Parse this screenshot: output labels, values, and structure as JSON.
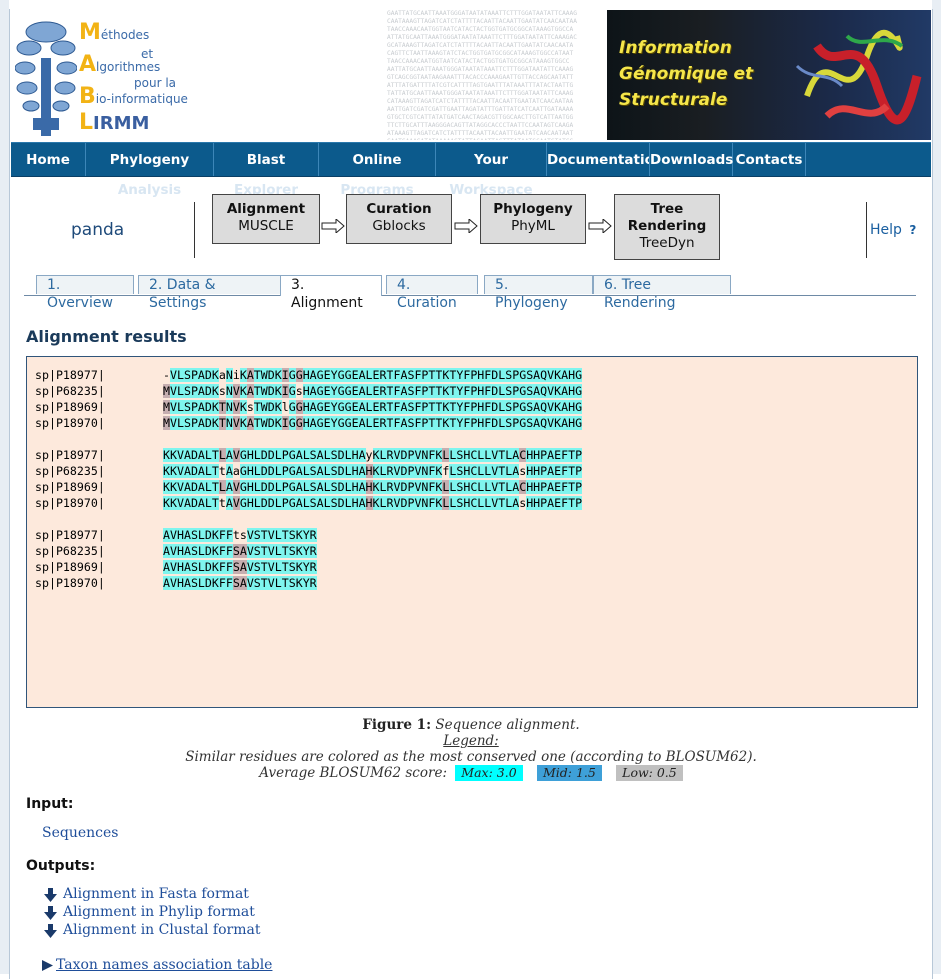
{
  "banner": {
    "logo_lines": [
      "éthodes",
      "et",
      "lgorithmes",
      "pour la",
      "io-informatique",
      "IRMM"
    ],
    "logo_caps": [
      "M",
      "A",
      "B",
      "L"
    ],
    "right_title": [
      "Information",
      "Génomique et",
      "Structurale"
    ],
    "seq_text": "GAATTATGCAATTAAATGGGATAATATAAATTCTTTGGATAATATTCAAAG\nCAATAAAGTTAGATCATCTATTTTACAATTACAATTGAATATCAACAATAA\nTAACCAAACAATGGTAATCATACTACTGGTGATGCGGCATAAAGTGGCCA\nATTATGCAATTAAATGGGATAATATAAATTCTTTGGATAATATTCAAAGAC\nGCATAAAGTTAGATCATCTATTTTACAATTACAATTGAATATCAACAATA\nCAGTTCTAATTAAAGTATCTACTGGTGATGCGGCATAAAGTGGCCATAAT\nTAACCAAACAATGGTAATCATACTACTGGTGATGCGGCATAAAGTGGCC\nAATTATGCAATTAAATGGGATAATATAAATTCTTTGGATAATATTCAAAG\nGTCAGCGGTAATAAGAAATTTACACCCAAAGAATTGTTACCAGCAATATT\nATTTATGATTTTATCGTCATTTTAGTGAATTTATAAATTTATACTAATTG\nTATTATGCAATTAAATGGGATAATATAAATTCTTTGGATAATATTCAAAG\nCATAAAGTTAGATCATCTATTTTACAATTACAATTGAATATCAACAATAA\nAATTGATCGATCGATTGAATTAGATATTTGATTATCATCAATTGATAAAA\nGTGCTCGTCATTATATGATCAACTAGACGTTGGCAACTTGTCATTAATGG\nTTCTTGCATTTAAGGGACAGTTATAGGCACCCTAATTCCAATAGTCAAGA\nATAAAGTTAGATCATCTATTTTACAATTACAATTGAATATCAACAATAAT\nGAATGAAAGATATAAAAAGTATTAGAATTAGTTTATAATGCAATGTATCG"
  },
  "nav": {
    "items": [
      "Home",
      "Phylogeny",
      "Blast",
      "Online",
      "Your",
      "Documentatio",
      "Downloads",
      "Contacts"
    ],
    "sub": [
      "Analysis",
      "Explorer",
      "Programs",
      "Workspace"
    ]
  },
  "workflow": {
    "project": "panda",
    "steps": [
      {
        "title": "Alignment",
        "tool": "MUSCLE"
      },
      {
        "title": "Curation",
        "tool": "Gblocks"
      },
      {
        "title": "Phylogeny",
        "tool": "PhyML"
      },
      {
        "title": "Tree\nRendering",
        "tool": "TreeDyn"
      }
    ],
    "help": "Help"
  },
  "tabs": [
    "1. Overview",
    "2. Data & Settings",
    "3. Alignment",
    "4. Curation",
    "5. Phylogeny",
    "6. Tree Rendering"
  ],
  "active_tab": "3. Alignment",
  "results_title": "Alignment results",
  "alignment": {
    "blocks": [
      [
        {
          "name": "sp|P18977|",
          "seq": "-VLSPADKaNiKATWDKIGGHAGEYGGEALERTFASFPTTKTYFPHFDLSPGSAQVKAHG"
        },
        {
          "name": "sp|P68235|",
          "seq": "MVLSPADKsNVKATWDKIGsHAGEYGGEALERTFASFPTTKTYFPHFDLSPGSAQVKAHG"
        },
        {
          "name": "sp|P18969|",
          "seq": "MVLSPADKTNVKsTWDKlGGHAGEYGGEALERTFASFPTTKTYFPHFDLSPGSAQVKAHG"
        },
        {
          "name": "sp|P18970|",
          "seq": "MVLSPADKTNVKATWDKIGGHAGEYGGEALERTFASFPTTKTYFPHFDLSPGSAQVKAHG"
        }
      ],
      [
        {
          "name": "sp|P18977|",
          "seq": "KKVADALTLAVGHLDDLPGALSALSDLHAyKLRVDPVNFKLLSHCLLVTLACHHPAEFTP"
        },
        {
          "name": "sp|P68235|",
          "seq": "KKVADALTtAaGHLDDLPGALSALSDLHAHKLRVDPVNFKfLSHCLLVTLAsHHPAEFTP"
        },
        {
          "name": "sp|P18969|",
          "seq": "KKVADALTLAVGHLDDLPGALSALSDLHAHKLRVDPVNFKLLSHCLLVTLACHHPAEFTP"
        },
        {
          "name": "sp|P18970|",
          "seq": "KKVADALTtAVGHLDDLPGALSALSDLHAHKLRVDPVNFKLLSHCLLVTLAsHHPAEFTP"
        }
      ],
      [
        {
          "name": "sp|P18977|",
          "seq": "AVHASLDKFFtsVSTVLTSKYR"
        },
        {
          "name": "sp|P68235|",
          "seq": "AVHASLDKFFSAVSTVLTSKYR"
        },
        {
          "name": "sp|P18969|",
          "seq": "AVHASLDKFFSAVSTVLTSKYR"
        },
        {
          "name": "sp|P18970|",
          "seq": "AVHASLDKFFSAVSTVLTSKYR"
        }
      ]
    ]
  },
  "caption": {
    "figure_label": "Figure 1:",
    "figure_text": "Sequence alignment.",
    "legend": "Legend:",
    "line2": "Similar residues are colored as the most conserved one (according to BLOSUM62).",
    "line3": "Average BLOSUM62 score:",
    "max": "Max: 3.0",
    "mid": "Mid: 1.5",
    "low": "Low: 0.5",
    "colors": {
      "max": "#00ffff",
      "mid": "#3ea0d8",
      "low": "#c0c0c0"
    }
  },
  "input": {
    "heading": "Input:",
    "link": "Sequences"
  },
  "outputs": {
    "heading": "Outputs:",
    "links": [
      "Alignment in Fasta format",
      "Alignment in Phylip format",
      "Alignment in Clustal format"
    ]
  },
  "taxon_link": "Taxon names association table"
}
